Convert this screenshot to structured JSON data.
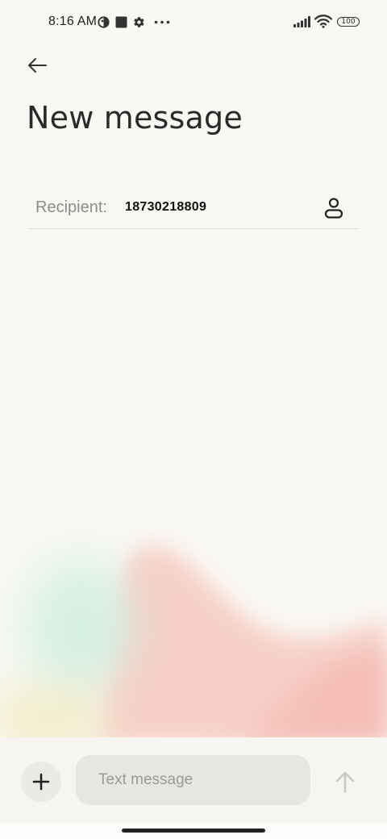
{
  "status_bar": {
    "time": "8:16 AM",
    "left_icons": [
      "vpn-half-circle-icon",
      "square-notification-icon",
      "gear-icon",
      "more-dots-icon"
    ],
    "right_icons": [
      "signal-icon",
      "wifi-icon",
      "battery-icon"
    ],
    "battery_level": "100"
  },
  "header": {
    "back_icon": "arrow-left-icon",
    "title": "New message"
  },
  "recipient": {
    "label": "Recipient:",
    "value": "18730218809",
    "contact_icon": "person-icon"
  },
  "compose": {
    "add_icon": "plus-icon",
    "placeholder": "Text message",
    "value": "",
    "send_icon": "arrow-up-icon"
  },
  "colors": {
    "background": "#f9f8f4",
    "input_background": "#e7e6e2",
    "placeholder": "#9a9a97",
    "label_gray": "#8c8c8c",
    "send_disabled": "#c7c7c3"
  }
}
